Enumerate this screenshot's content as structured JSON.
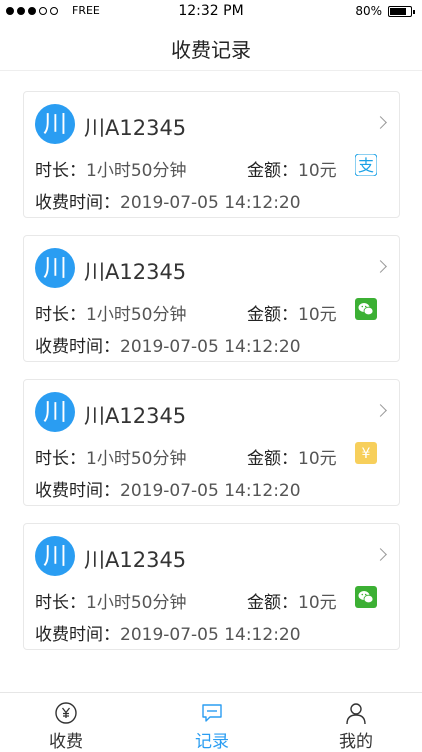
{
  "status_bar": {
    "carrier": "FREE",
    "time": "12:32 PM",
    "battery": "80%",
    "battery_level": 0.8
  },
  "nav": {
    "title": "收费记录"
  },
  "records": [
    {
      "badge": "川",
      "plate": "川A12345",
      "duration_label": "时长：",
      "duration_value": "1小时50分钟",
      "amount_label": "金额：",
      "amount_value": "10元",
      "pay_icon": "alipay-icon",
      "time_label": "收费时间：",
      "time_value": "2019-07-05 14:12:20"
    },
    {
      "badge": "川",
      "plate": "川A12345",
      "duration_label": "时长：",
      "duration_value": "1小时50分钟",
      "amount_label": "金额：",
      "amount_value": "10元",
      "pay_icon": "wechat-pay-icon",
      "time_label": "收费时间：",
      "time_value": "2019-07-05 14:12:20"
    },
    {
      "badge": "川",
      "plate": "川A12345",
      "duration_label": "时长：",
      "duration_value": "1小时50分钟",
      "amount_label": "金额：",
      "amount_value": "10元",
      "pay_icon": "cash-icon",
      "time_label": "收费时间：",
      "time_value": "2019-07-05 14:12:20"
    },
    {
      "badge": "川",
      "plate": "川A12345",
      "duration_label": "时长：",
      "duration_value": "1小时50分钟",
      "amount_label": "金额：",
      "amount_value": "10元",
      "pay_icon": "wechat-pay-icon",
      "time_label": "收费时间：",
      "time_value": "2019-07-05 14:12:20"
    }
  ],
  "pay_icon_glyphs": {
    "alipay": "支",
    "cash": "¥"
  },
  "tabs": [
    {
      "label": "收费",
      "icon": "yuan-coin-icon",
      "active": false
    },
    {
      "label": "记录",
      "icon": "chat-record-icon",
      "active": true
    },
    {
      "label": "我的",
      "icon": "user-icon",
      "active": false
    }
  ],
  "colors": {
    "accent": "#2a9df2",
    "alipay": "#1aa1e6",
    "wechat": "#3cb034",
    "cash": "#f7cf5b"
  }
}
